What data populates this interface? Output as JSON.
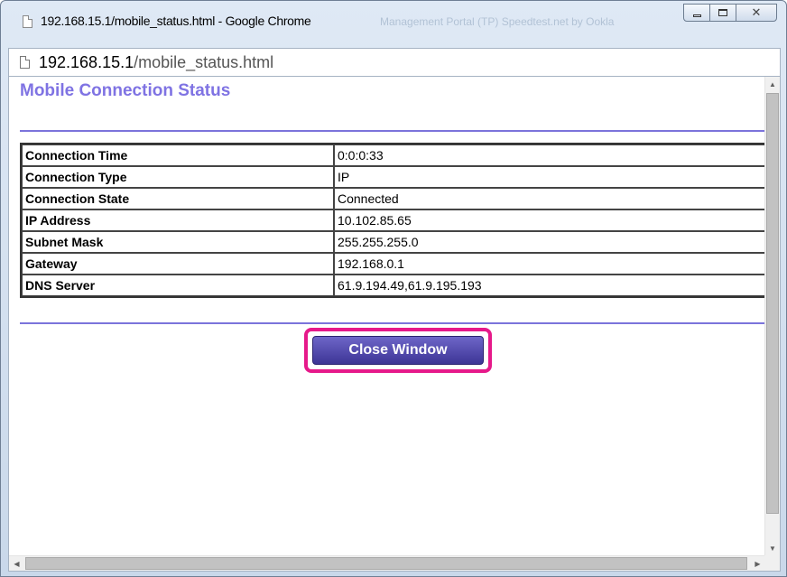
{
  "window": {
    "title": "192.168.15.1/mobile_status.html - Google Chrome",
    "background_tab_text": "Management Portal   (TP) Speedtest.net by Ookla"
  },
  "address_bar": {
    "host": "192.168.15.1",
    "path": "/mobile_status.html"
  },
  "page": {
    "heading": "Mobile Connection Status",
    "rows": [
      {
        "label": "Connection Time",
        "value": "0:0:0:33"
      },
      {
        "label": "Connection Type",
        "value": "IP"
      },
      {
        "label": "Connection State",
        "value": "Connected"
      },
      {
        "label": "IP Address",
        "value": "10.102.85.65"
      },
      {
        "label": "Subnet Mask",
        "value": "255.255.255.0"
      },
      {
        "label": "Gateway",
        "value": "192.168.0.1"
      },
      {
        "label": "DNS Server",
        "value": "61.9.194.49,61.9.195.193"
      }
    ],
    "close_button_label": "Close Window"
  },
  "colors": {
    "heading": "#7f73e3",
    "rule": "#7b74db",
    "button_top": "#6e66c8",
    "button_bottom": "#3d3596",
    "highlight": "#e6198a"
  },
  "icons": {
    "title_page": "page-icon",
    "address_page": "page-icon",
    "minimize": "minimize-icon",
    "maximize": "maximize-icon",
    "close": "close-icon"
  }
}
